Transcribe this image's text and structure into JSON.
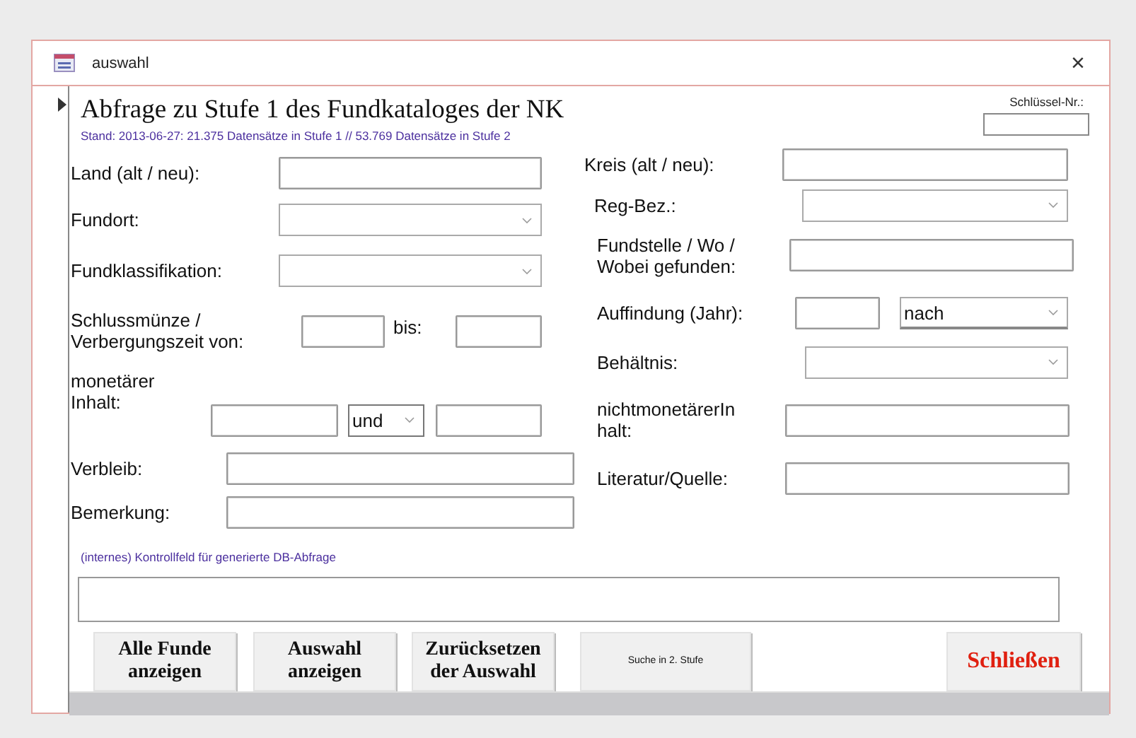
{
  "window": {
    "title": "auswahl",
    "close": "×"
  },
  "form": {
    "title": "Abfrage zu Stufe 1 des Fundkataloges der NK",
    "subtitle": "Stand: 2013-06-27: 21.375 Datensätze in Stufe 1 // 53.769 Datensätze in Stufe 2",
    "key_label": "Schlüssel-Nr.:",
    "left_fields": [
      {
        "kind": "text",
        "label": "Land (alt / neu):"
      },
      {
        "kind": "combo",
        "label": "Fundort:"
      },
      {
        "kind": "combo",
        "label": "Fundklassifikation:"
      },
      {
        "kind": "range",
        "label": "Schlussmünze / Verbergungszeit von:",
        "separator": "bis:"
      },
      {
        "kind": "range_combo",
        "label": "monetärer Inhalt:",
        "operator": "und"
      },
      {
        "kind": "text",
        "label": "Verbleib:"
      },
      {
        "kind": "text",
        "label": "Bemerkung:"
      }
    ],
    "right_fields": [
      {
        "kind": "text",
        "label": "Kreis (alt / neu):"
      },
      {
        "kind": "combo",
        "label": "Reg-Bez.:"
      },
      {
        "kind": "text",
        "label": "Fundstelle / Wo / Wobei gefunden:"
      },
      {
        "kind": "year_combo",
        "label": "Auffindung (Jahr):",
        "operator": "nach"
      },
      {
        "kind": "combo",
        "label": "Behältnis:"
      },
      {
        "kind": "text",
        "label": "nichtmonetärerIn halt:"
      },
      {
        "kind": "text",
        "label": "Literatur/Quelle:"
      }
    ],
    "query_label": "(internes) Kontrollfeld für generierte DB-Abfrage",
    "buttons": [
      {
        "label": "Alle Funde anzeigen",
        "kind": "bold"
      },
      {
        "label": "Auswahl anzeigen",
        "kind": "bold"
      },
      {
        "label": "Zurücksetzen der Auswahl",
        "kind": "bold"
      },
      {
        "label": "Suche in 2. Stufe",
        "kind": "small"
      },
      {
        "label": "Schließen",
        "kind": "close"
      }
    ]
  }
}
